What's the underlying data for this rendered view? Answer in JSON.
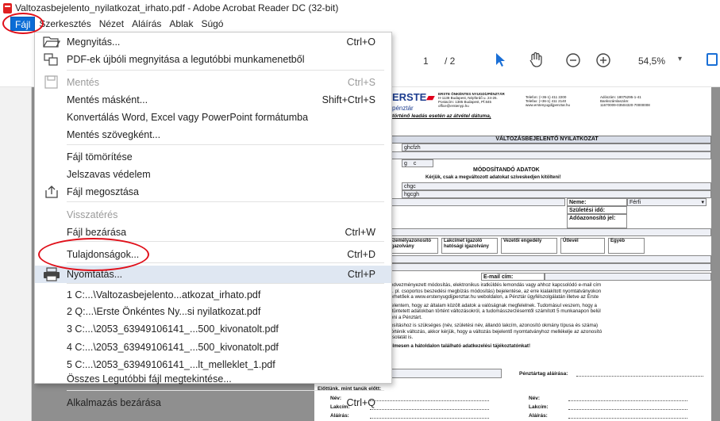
{
  "window": {
    "title": "Valtozasbejelento_nyilatkozat_irhato.pdf - Adobe Acrobat Reader DC (32-bit)"
  },
  "menubar": [
    "Fájl",
    "Szerkesztés",
    "Nézet",
    "Aláírás",
    "Ablak",
    "Súgó"
  ],
  "toolbar": {
    "page_current": "1",
    "page_sep": "/ 2",
    "zoom": "54,5%"
  },
  "file_menu": {
    "items": [
      {
        "label": "Megnyitás...",
        "shortcut": "Ctrl+O",
        "disabled": false,
        "icon": "folder-open-icon"
      },
      {
        "label": "PDF-ek újbóli megnyitása a legutóbbi munkamenetből",
        "shortcut": "",
        "disabled": false,
        "icon": "reopen-files-icon"
      },
      {
        "label": "Mentés",
        "shortcut": "Ctrl+S",
        "disabled": true,
        "icon": "save-icon"
      },
      {
        "label": "Mentés másként...",
        "shortcut": "Shift+Ctrl+S",
        "disabled": false,
        "icon": ""
      },
      {
        "label": "Konvertálás Word, Excel vagy PowerPoint formátumba",
        "shortcut": "",
        "disabled": false,
        "icon": ""
      },
      {
        "label": "Mentés szövegként...",
        "shortcut": "",
        "disabled": false,
        "icon": ""
      },
      {
        "label": "Fájl tömörítése",
        "shortcut": "",
        "disabled": false,
        "icon": ""
      },
      {
        "label": "Jelszavas védelem",
        "shortcut": "",
        "disabled": false,
        "icon": ""
      },
      {
        "label": "Fájl megosztása",
        "shortcut": "",
        "disabled": false,
        "icon": "share-icon"
      },
      {
        "label": "Visszatérés",
        "shortcut": "",
        "disabled": true,
        "icon": ""
      },
      {
        "label": "Fájl bezárása",
        "shortcut": "Ctrl+W",
        "disabled": false,
        "icon": ""
      },
      {
        "label": "Tulajdonságok...",
        "shortcut": "Ctrl+D",
        "disabled": false,
        "icon": ""
      },
      {
        "label": "Nyomtatás...",
        "shortcut": "Ctrl+P",
        "disabled": false,
        "icon": "printer-icon",
        "highlighted": true
      },
      {
        "label": "1 C:...\\Valtozasbejelento...atkozat_irhato.pdf",
        "shortcut": "",
        "disabled": false,
        "icon": ""
      },
      {
        "label": "2 Q:...\\Erste Önkéntes Ny...si nyilatkozat.pdf",
        "shortcut": "",
        "disabled": false,
        "icon": ""
      },
      {
        "label": "3 C:...\\2053_63949106141_...500_kivonatolt.pdf",
        "shortcut": "",
        "disabled": false,
        "icon": ""
      },
      {
        "label": "4 C:...\\2053_63949106141_...500_kivonatolt.pdf",
        "shortcut": "",
        "disabled": false,
        "icon": ""
      },
      {
        "label": "5 C:...\\2053_63949106141_...lt_melleklet_1.pdf",
        "shortcut": "",
        "disabled": false,
        "icon": ""
      },
      {
        "label": "Összes Legutóbbi fájl megtekintése...",
        "shortcut": "",
        "disabled": false,
        "icon": ""
      },
      {
        "label": "Alkalmazás bezárása",
        "shortcut": "Ctrl+Q",
        "disabled": false,
        "icon": ""
      }
    ]
  },
  "document": {
    "logo": "ERSTE",
    "logo_sub": "pénztár",
    "header_lines": [
      "ERSTE ÖNKÉNTES NYUGDÍJPÉNZTÁR",
      "H-1138 Budapest, Népfürdő u. 24-26.",
      "Postacím: 1385 Budapest, Pf.845",
      "office@erstenyp.hu"
    ],
    "contact_lines": [
      "Telefon: (+36-1) 411 2200",
      "Telefax: (+36-1) 411 2140",
      "www.erstenyugdijpenztar.hu"
    ],
    "account_lines": [
      "Adószám: 18075295-1-41",
      "Bankszámlaszám:",
      "11670009-03504320-70000008"
    ],
    "date_note": "történő leadás esetén az átvétel dátuma,",
    "section_title": "VÁLTOZÁSBEJELENTŐ NYILATKOZAT",
    "field1": "ghcfzh",
    "field2": "g c",
    "subtitle": "MÓDOSÍTANDÓ ADATOK",
    "subtitle_note": "Kérjük, csak a megváltozott adatokat szíveskedjen kitölteni!",
    "field3": "chgc",
    "field4": "hgcgh",
    "neme_label": "Neme:",
    "neme_value": "Férfi",
    "szuletesi_ido": "Születési idő:",
    "adoazonosito": "Adóazonosító jel:",
    "doc_types": [
      "Személyazonosító igazolvány",
      "Lakcímet igazoló hatósági igazolvány",
      "Vezetői engedély",
      "Útlevél",
      "Egyéb"
    ],
    "email_label": "E-mail cím:",
    "body_lines": [
      "k (kedvezményezett módosítás, elektronikus iratküldés lemondás vagy ahhoz kapcsolódó e-mail cím",
      "mód. pl. csoportos beszedési megbízás módosítás) bejelentése, az erre kialakított nyomtatványokon",
      "k elérhetőek a www.erstenyugdijpenztar.hu weboldalon, a Pénztár ügyfélszolgálatán illetve az Erste",
      "g kijelentem, hogy az általam közölt adatok a valóságnak megfelelnek. Tudomásul veszem, hogy a",
      "n feltüntetett adatokban történt változásokról, a tudomásszerzésemtől számított 5 munkanapon belül",
      "esíteni a Pénztárt.",
      "zonosításhoz is szükséges (név, születési név, állandó lakcím, azonosító okmány típusa és száma)",
      "an történik változás, akkor kérjük, hogy a változás bejelentő nyomtatványhoz mellékelje az azonosító",
      "t másolatát is.",
      "igyelmesen a hátoldalon található adatkezelési tájékoztatónkat!"
    ],
    "penztar_alairasa": "Pénztártag aláírása:",
    "witness_title": "Előttünk, mint tanúk előtt:",
    "witness_fields": [
      "Név:",
      "Lakcím:",
      "Aláírás:"
    ]
  }
}
